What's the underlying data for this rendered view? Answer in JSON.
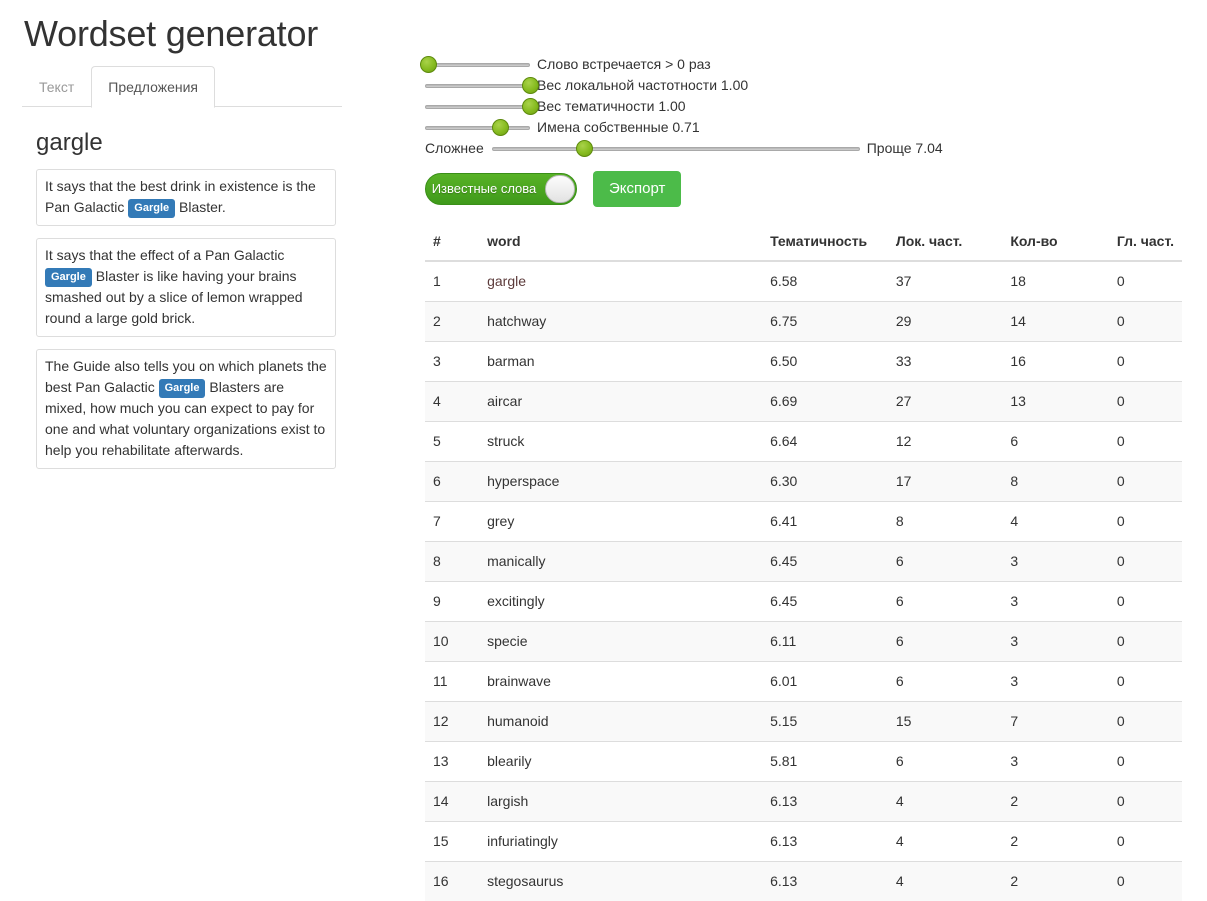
{
  "app": {
    "title": "Wordset generator"
  },
  "tabs": [
    {
      "label": "Текст",
      "active": false
    },
    {
      "label": "Предложения",
      "active": true
    }
  ],
  "selected_word": "gargle",
  "sentences": [
    {
      "parts": [
        {
          "type": "text",
          "text": "It says that the best drink in existence is the Pan Galactic "
        },
        {
          "type": "badge",
          "text": "Gargle"
        },
        {
          "type": "text",
          "text": " Blaster."
        }
      ]
    },
    {
      "parts": [
        {
          "type": "text",
          "text": "It says that the effect of a Pan Galactic "
        },
        {
          "type": "badge",
          "text": "Gargle"
        },
        {
          "type": "text",
          "text": " Blaster is like having your brains smashed out by a slice of lemon wrapped round a large gold brick."
        }
      ]
    },
    {
      "parts": [
        {
          "type": "text",
          "text": "The Guide also tells you on which planets the best Pan Galactic "
        },
        {
          "type": "badge",
          "text": "Gargle"
        },
        {
          "type": "text",
          "text": " Blasters are mixed, how much you can expect to pay for one and what voluntary organizations exist to help you rehabilitate afterwards."
        }
      ]
    }
  ],
  "sliders": [
    {
      "prefix": "",
      "label": "Слово встречается > 0 раз",
      "value_pct": 3,
      "width": "short"
    },
    {
      "prefix": "",
      "label": "Вес локальной частотности 1.00",
      "value_pct": 100,
      "width": "short"
    },
    {
      "prefix": "",
      "label": "Вес тематичности 1.00",
      "value_pct": 100,
      "width": "short"
    },
    {
      "prefix": "",
      "label": "Имена собственные 0.71",
      "value_pct": 71,
      "width": "short"
    }
  ],
  "difficulty_slider": {
    "prefix": "Сложнее",
    "label": "Проще 7.04",
    "value_pct": 25,
    "width": "long"
  },
  "controls": {
    "toggle_label": "Известные слова",
    "export_label": "Экспорт"
  },
  "table": {
    "columns": [
      "#",
      "word",
      "Тематичность",
      "Лок. част.",
      "Кол-во",
      "Гл. част."
    ],
    "rows": [
      {
        "idx": "1",
        "word": "gargle",
        "visited": true,
        "tematichnost": "6.58",
        "lok": "37",
        "kol": "18",
        "gl": "0"
      },
      {
        "idx": "2",
        "word": "hatchway",
        "visited": false,
        "tematichnost": "6.75",
        "lok": "29",
        "kol": "14",
        "gl": "0"
      },
      {
        "idx": "3",
        "word": "barman",
        "visited": false,
        "tematichnost": "6.50",
        "lok": "33",
        "kol": "16",
        "gl": "0"
      },
      {
        "idx": "4",
        "word": "aircar",
        "visited": false,
        "tematichnost": "6.69",
        "lok": "27",
        "kol": "13",
        "gl": "0"
      },
      {
        "idx": "5",
        "word": "struck",
        "visited": false,
        "tematichnost": "6.64",
        "lok": "12",
        "kol": "6",
        "gl": "0"
      },
      {
        "idx": "6",
        "word": "hyperspace",
        "visited": false,
        "tematichnost": "6.30",
        "lok": "17",
        "kol": "8",
        "gl": "0"
      },
      {
        "idx": "7",
        "word": "grey",
        "visited": false,
        "tematichnost": "6.41",
        "lok": "8",
        "kol": "4",
        "gl": "0"
      },
      {
        "idx": "8",
        "word": "manically",
        "visited": false,
        "tematichnost": "6.45",
        "lok": "6",
        "kol": "3",
        "gl": "0"
      },
      {
        "idx": "9",
        "word": "excitingly",
        "visited": false,
        "tematichnost": "6.45",
        "lok": "6",
        "kol": "3",
        "gl": "0"
      },
      {
        "idx": "10",
        "word": "specie",
        "visited": false,
        "tematichnost": "6.11",
        "lok": "6",
        "kol": "3",
        "gl": "0"
      },
      {
        "idx": "11",
        "word": "brainwave",
        "visited": false,
        "tematichnost": "6.01",
        "lok": "6",
        "kol": "3",
        "gl": "0"
      },
      {
        "idx": "12",
        "word": "humanoid",
        "visited": false,
        "tematichnost": "5.15",
        "lok": "15",
        "kol": "7",
        "gl": "0"
      },
      {
        "idx": "13",
        "word": "blearily",
        "visited": false,
        "tematichnost": "5.81",
        "lok": "6",
        "kol": "3",
        "gl": "0"
      },
      {
        "idx": "14",
        "word": "largish",
        "visited": false,
        "tematichnost": "6.13",
        "lok": "4",
        "kol": "2",
        "gl": "0"
      },
      {
        "idx": "15",
        "word": "infuriatingly",
        "visited": false,
        "tematichnost": "6.13",
        "lok": "4",
        "kol": "2",
        "gl": "0"
      },
      {
        "idx": "16",
        "word": "stegosaurus",
        "visited": false,
        "tematichnost": "6.13",
        "lok": "4",
        "kol": "2",
        "gl": "0"
      }
    ]
  },
  "colors": {
    "badge_blue": "#337ab7",
    "toggle_green": "#4aa41f",
    "export_green": "#4cbb49",
    "slider_handle_green": "#86bb20"
  }
}
